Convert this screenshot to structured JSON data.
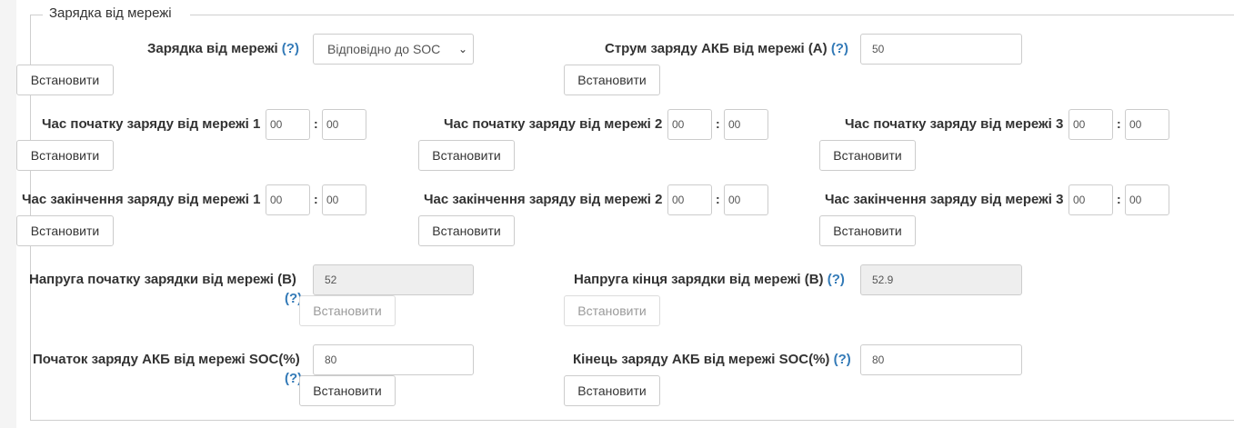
{
  "section": {
    "legend": "Зарядка від мережі"
  },
  "help": "(?)",
  "set_button": "Встановити",
  "colon": ":",
  "charge_mode": {
    "label": "Зарядка від мережі",
    "selected": "Відповідно до SOC"
  },
  "charge_current": {
    "label": "Струм заряду АКБ від мережі (А)",
    "value": "50"
  },
  "start_times": [
    {
      "label": "Час початку заряду від мережі 1",
      "hour": "00",
      "minute": "00"
    },
    {
      "label": "Час початку заряду від мережі 2",
      "hour": "00",
      "minute": "00"
    },
    {
      "label": "Час початку заряду від мережі 3",
      "hour": "00",
      "minute": "00"
    }
  ],
  "end_times": [
    {
      "label": "Час закінчення заряду від мережі 1",
      "hour": "00",
      "minute": "00"
    },
    {
      "label": "Час закінчення заряду від мережі 2",
      "hour": "00",
      "minute": "00"
    },
    {
      "label": "Час закінчення заряду від мережі 3",
      "hour": "00",
      "minute": "00"
    }
  ],
  "voltage_start": {
    "label": "Напруга початку зарядки від мережі (В)",
    "value": "52"
  },
  "voltage_end": {
    "label": "Напруга кінця зарядки від мережі (В)",
    "value": "52.9"
  },
  "soc_start": {
    "label": "Початок заряду АКБ від мережі SOC(%)",
    "value": "80"
  },
  "soc_end": {
    "label": "Кінець заряду АКБ від мережі SOC(%)",
    "value": "80"
  }
}
